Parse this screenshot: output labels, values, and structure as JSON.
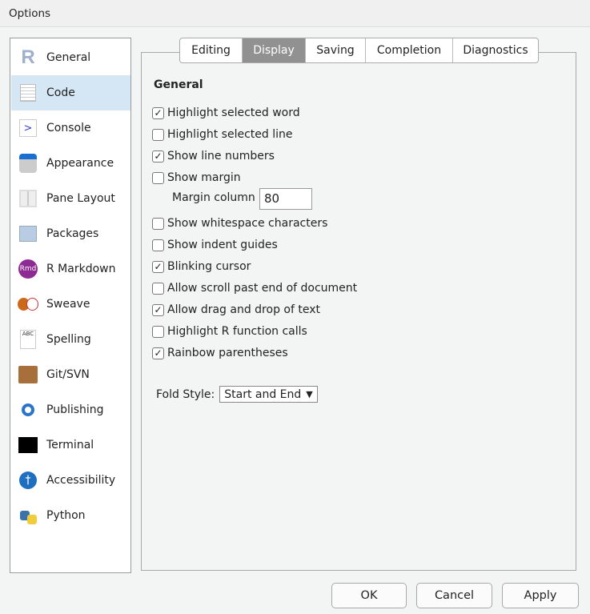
{
  "window": {
    "title": "Options"
  },
  "sidebar": {
    "items": [
      {
        "label": "General",
        "icon": "r-logo-icon"
      },
      {
        "label": "Code",
        "icon": "code-document-icon",
        "selected": true
      },
      {
        "label": "Console",
        "icon": "console-prompt-icon"
      },
      {
        "label": "Appearance",
        "icon": "paint-bucket-icon"
      },
      {
        "label": "Pane Layout",
        "icon": "pane-grid-icon"
      },
      {
        "label": "Packages",
        "icon": "package-box-icon"
      },
      {
        "label": "R Markdown",
        "icon": "rmd-icon"
      },
      {
        "label": "Sweave",
        "icon": "sweave-pdf-icon"
      },
      {
        "label": "Spelling",
        "icon": "spellcheck-icon"
      },
      {
        "label": "Git/SVN",
        "icon": "git-box-icon"
      },
      {
        "label": "Publishing",
        "icon": "publishing-icon"
      },
      {
        "label": "Terminal",
        "icon": "terminal-icon"
      },
      {
        "label": "Accessibility",
        "icon": "accessibility-icon"
      },
      {
        "label": "Python",
        "icon": "python-icon"
      }
    ]
  },
  "tabs": [
    {
      "label": "Editing"
    },
    {
      "label": "Display",
      "active": true
    },
    {
      "label": "Saving"
    },
    {
      "label": "Completion"
    },
    {
      "label": "Diagnostics"
    }
  ],
  "section": {
    "heading": "General"
  },
  "options": [
    {
      "label": "Highlight selected word",
      "checked": true
    },
    {
      "label": "Highlight selected line",
      "checked": false
    },
    {
      "label": "Show line numbers",
      "checked": true
    },
    {
      "label": "Show margin",
      "checked": false
    },
    {
      "label": "Show whitespace characters",
      "checked": false
    },
    {
      "label": "Show indent guides",
      "checked": false
    },
    {
      "label": "Blinking cursor",
      "checked": true
    },
    {
      "label": "Allow scroll past end of document",
      "checked": false
    },
    {
      "label": "Allow drag and drop of text",
      "checked": true
    },
    {
      "label": "Highlight R function calls",
      "checked": false
    },
    {
      "label": "Rainbow parentheses",
      "checked": true
    }
  ],
  "margin": {
    "label": "Margin column",
    "value": "80"
  },
  "fold": {
    "label": "Fold Style:",
    "value": "Start and End",
    "arrow": "▼"
  },
  "buttons": {
    "ok": "OK",
    "cancel": "Cancel",
    "apply": "Apply"
  },
  "icons": {
    "check": "✓",
    "console": ">",
    "rmd": "Rmd",
    "abc": "ABC"
  }
}
